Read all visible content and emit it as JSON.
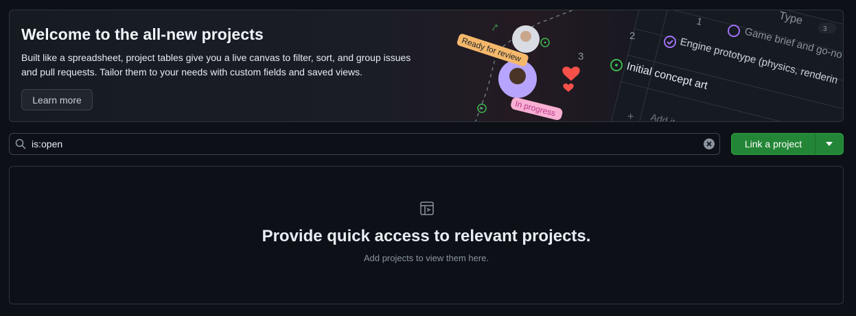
{
  "banner": {
    "title": "Welcome to the all-new projects",
    "description": "Built like a spreadsheet, project tables give you a live canvas to filter, sort, and group issues and pull requests. Tailor them to your needs with custom fields and saved views.",
    "learn_more_label": "Learn more",
    "illustration": {
      "tags": [
        "Ready for review",
        "In progress"
      ],
      "rows": [
        {
          "num": "1",
          "text": "Type",
          "count": "3"
        },
        {
          "num": "2",
          "text": "Game brief and go-no"
        },
        {
          "num": "",
          "text": "Engine prototype (physics, renderin"
        },
        {
          "num": "3",
          "text": "Initial concept art"
        },
        {
          "num": "",
          "text": "Add item"
        }
      ]
    }
  },
  "search": {
    "value": "is:open",
    "icon": "search-icon",
    "clear_icon": "x-circle-fill-icon"
  },
  "link_button": {
    "label": "Link a project",
    "dropdown_icon": "triangle-down-icon"
  },
  "empty_state": {
    "icon": "project-icon",
    "title": "Provide quick access to relevant projects.",
    "subtitle": "Add projects to view them here."
  },
  "colors": {
    "page_bg": "#0d1117",
    "border": "#30363d",
    "accent_green": "#238636",
    "tag_yellow": "#f5b86b",
    "tag_pink": "#f7b0d4",
    "heart": "#f85149"
  }
}
